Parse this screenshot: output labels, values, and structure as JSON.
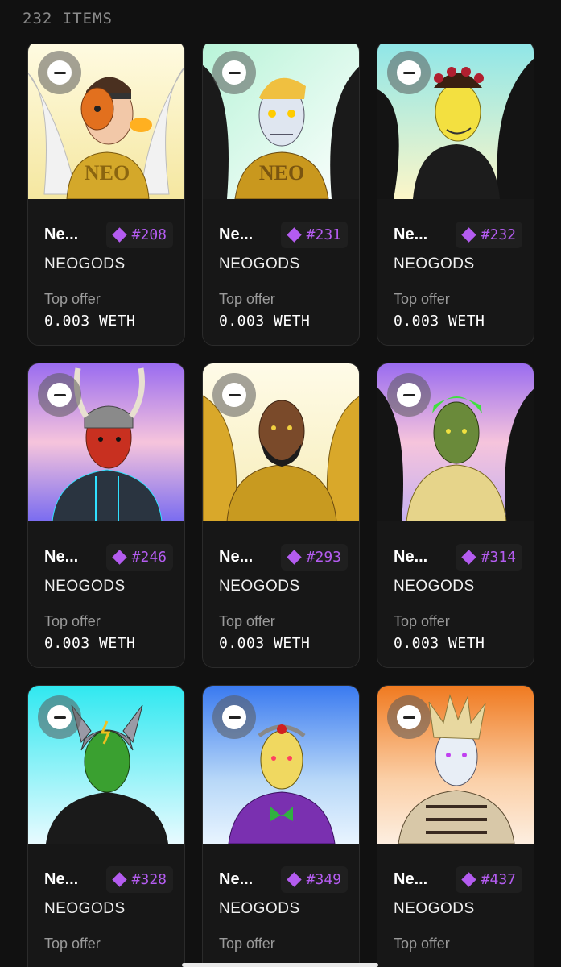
{
  "header": {
    "item_count": "232 ITEMS"
  },
  "colors": {
    "accent_purple": "#b45cf0",
    "background": "#111111",
    "card": "#171717"
  },
  "cards": [
    {
      "name": "Ne...",
      "token_id": "#208",
      "collection": "NEOGODS",
      "offer_label": "Top offer",
      "offer_value": "0.003 WETH"
    },
    {
      "name": "Ne...",
      "token_id": "#231",
      "collection": "NEOGODS",
      "offer_label": "Top offer",
      "offer_value": "0.003 WETH"
    },
    {
      "name": "Ne...",
      "token_id": "#232",
      "collection": "NEOGODS",
      "offer_label": "Top offer",
      "offer_value": "0.003 WETH"
    },
    {
      "name": "Ne...",
      "token_id": "#246",
      "collection": "NEOGODS",
      "offer_label": "Top offer",
      "offer_value": "0.003 WETH"
    },
    {
      "name": "Ne...",
      "token_id": "#293",
      "collection": "NEOGODS",
      "offer_label": "Top offer",
      "offer_value": "0.003 WETH"
    },
    {
      "name": "Ne...",
      "token_id": "#314",
      "collection": "NEOGODS",
      "offer_label": "Top offer",
      "offer_value": "0.003 WETH"
    },
    {
      "name": "Ne...",
      "token_id": "#328",
      "collection": "NEOGODS",
      "offer_label": "Top offer"
    },
    {
      "name": "Ne...",
      "token_id": "#349",
      "collection": "NEOGODS",
      "offer_label": "Top offer"
    },
    {
      "name": "Ne...",
      "token_id": "#437",
      "collection": "NEOGODS",
      "offer_label": "Top offer"
    }
  ]
}
